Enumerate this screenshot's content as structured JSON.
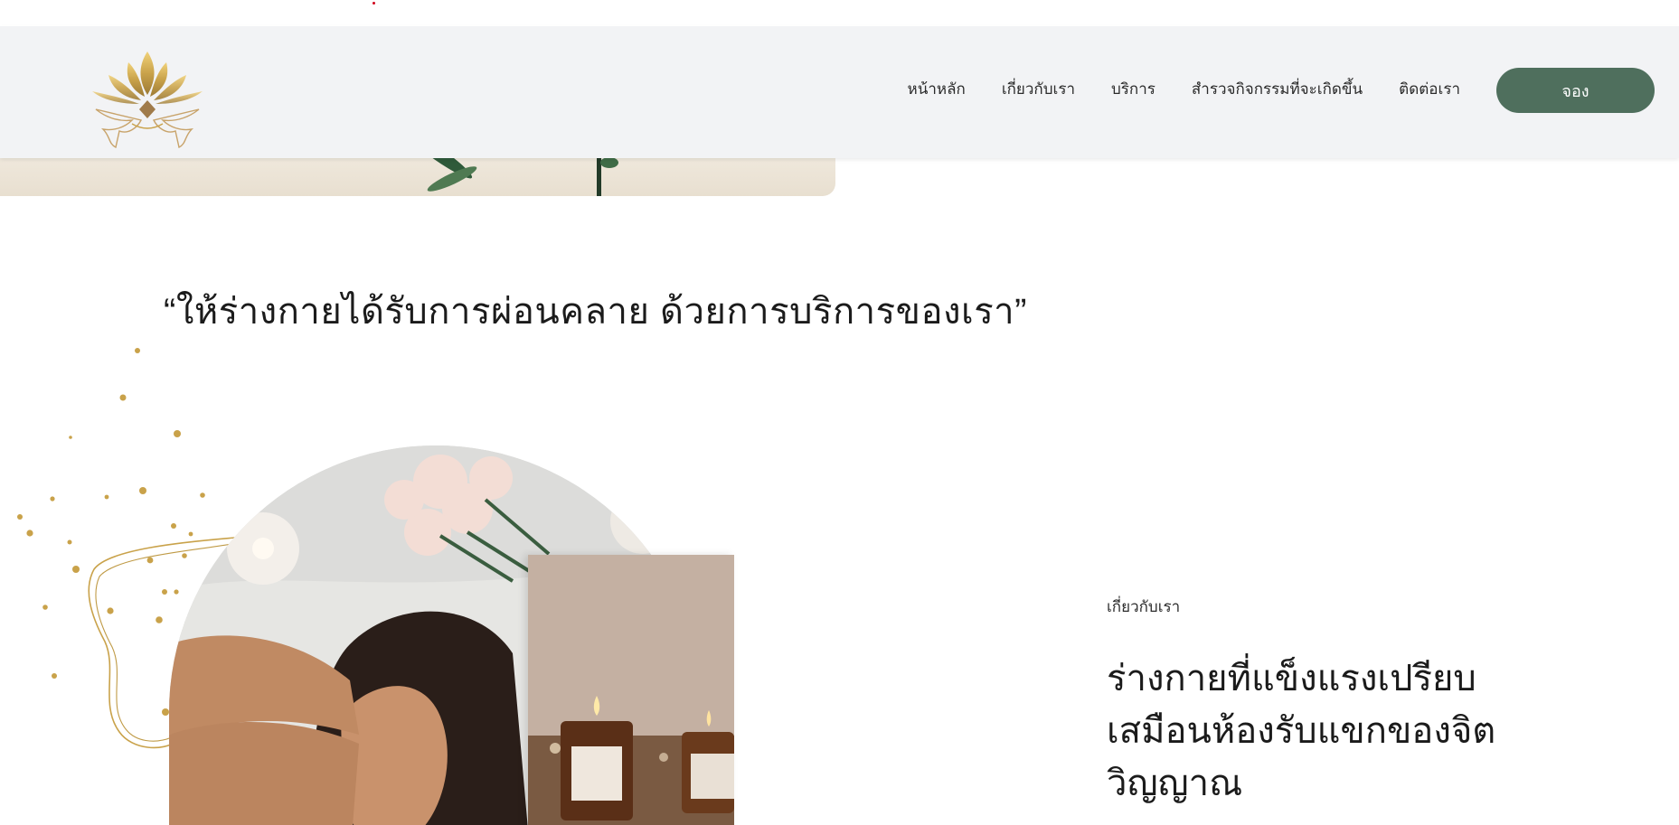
{
  "nav": {
    "items": [
      {
        "label": "หน้าหลัก"
      },
      {
        "label": "เกี่ยวกับเรา"
      },
      {
        "label": "บริการ"
      },
      {
        "label": "สำรวจกิจกรรมที่จะเกิดขึ้น"
      },
      {
        "label": "ติดต่อเรา"
      }
    ],
    "book_label": "จอง"
  },
  "hero": {
    "quote": "“ให้ร่างกายได้รับการผ่อนคลาย ด้วยการบริการของเรา”"
  },
  "about": {
    "label": "เกี่ยวกับเรา",
    "title": "ร่างกายที่แข็งแรงเปรียบเสมือนห้องรับแขกของจิตวิญญาณ"
  },
  "colors": {
    "header_bg": "#f2f3f5",
    "accent": "#4f6f5d",
    "text": "#1b1b1b"
  },
  "icons": {
    "logo": "golden-lotus-hands-logo"
  }
}
